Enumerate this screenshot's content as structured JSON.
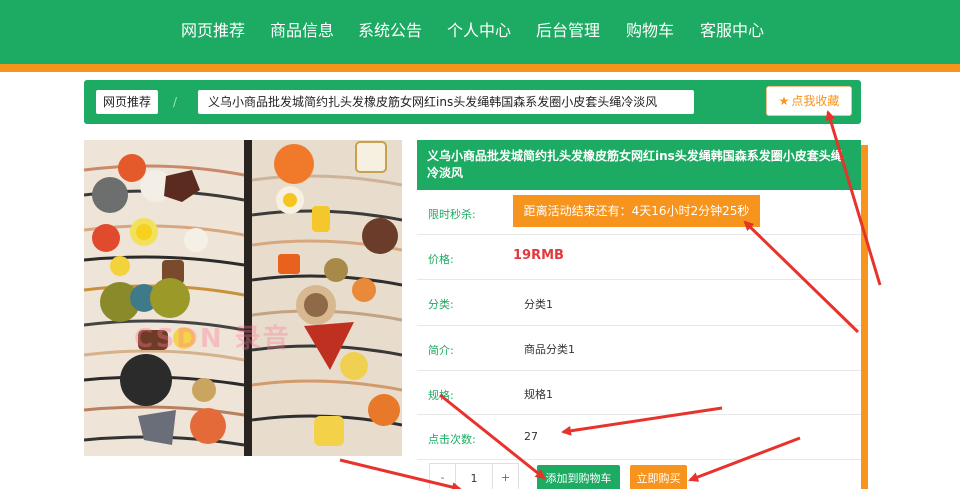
{
  "nav": {
    "items": [
      {
        "label": "网页推荐"
      },
      {
        "label": "商品信息"
      },
      {
        "label": "系统公告"
      },
      {
        "label": "个人中心"
      },
      {
        "label": "后台管理"
      },
      {
        "label": "购物车"
      },
      {
        "label": "客服中心"
      }
    ]
  },
  "breadcrumb": {
    "home": "网页推荐",
    "separator": "/",
    "current": "义乌小商品批发城简约扎头发橡皮筋女网红ins头发绳韩国森系发圈小皮套头绳冷淡风"
  },
  "favorite": {
    "label": "点我收藏",
    "icon": "star-icon"
  },
  "product": {
    "image_icon": "product-photo",
    "watermark": "CSDN 录音",
    "title": "义乌小商品批发城简约扎头发橡皮筋女网红ins头发绳韩国森系发圈小皮套头绳冷淡风",
    "flash_label": "限时秒杀:",
    "countdown": "距离活动结束还有：4天16小时2分钟25秒",
    "price_label": "价格:",
    "price": "19RMB",
    "category_label": "分类:",
    "category": "分类1",
    "intro_label": "简介:",
    "intro": "商品分类1",
    "spec_label": "规格:",
    "spec": "规格1",
    "clicks_label": "点击次数:",
    "clicks": "27"
  },
  "purchase": {
    "minus": "-",
    "quantity": "1",
    "plus": "+",
    "add_to_cart": "添加到购物车",
    "buy_now": "立即购买"
  },
  "colors": {
    "brand_green": "#1daa62",
    "accent_orange": "#f7941d",
    "price_red": "#e4393c",
    "arrow_red": "#e8322c"
  }
}
